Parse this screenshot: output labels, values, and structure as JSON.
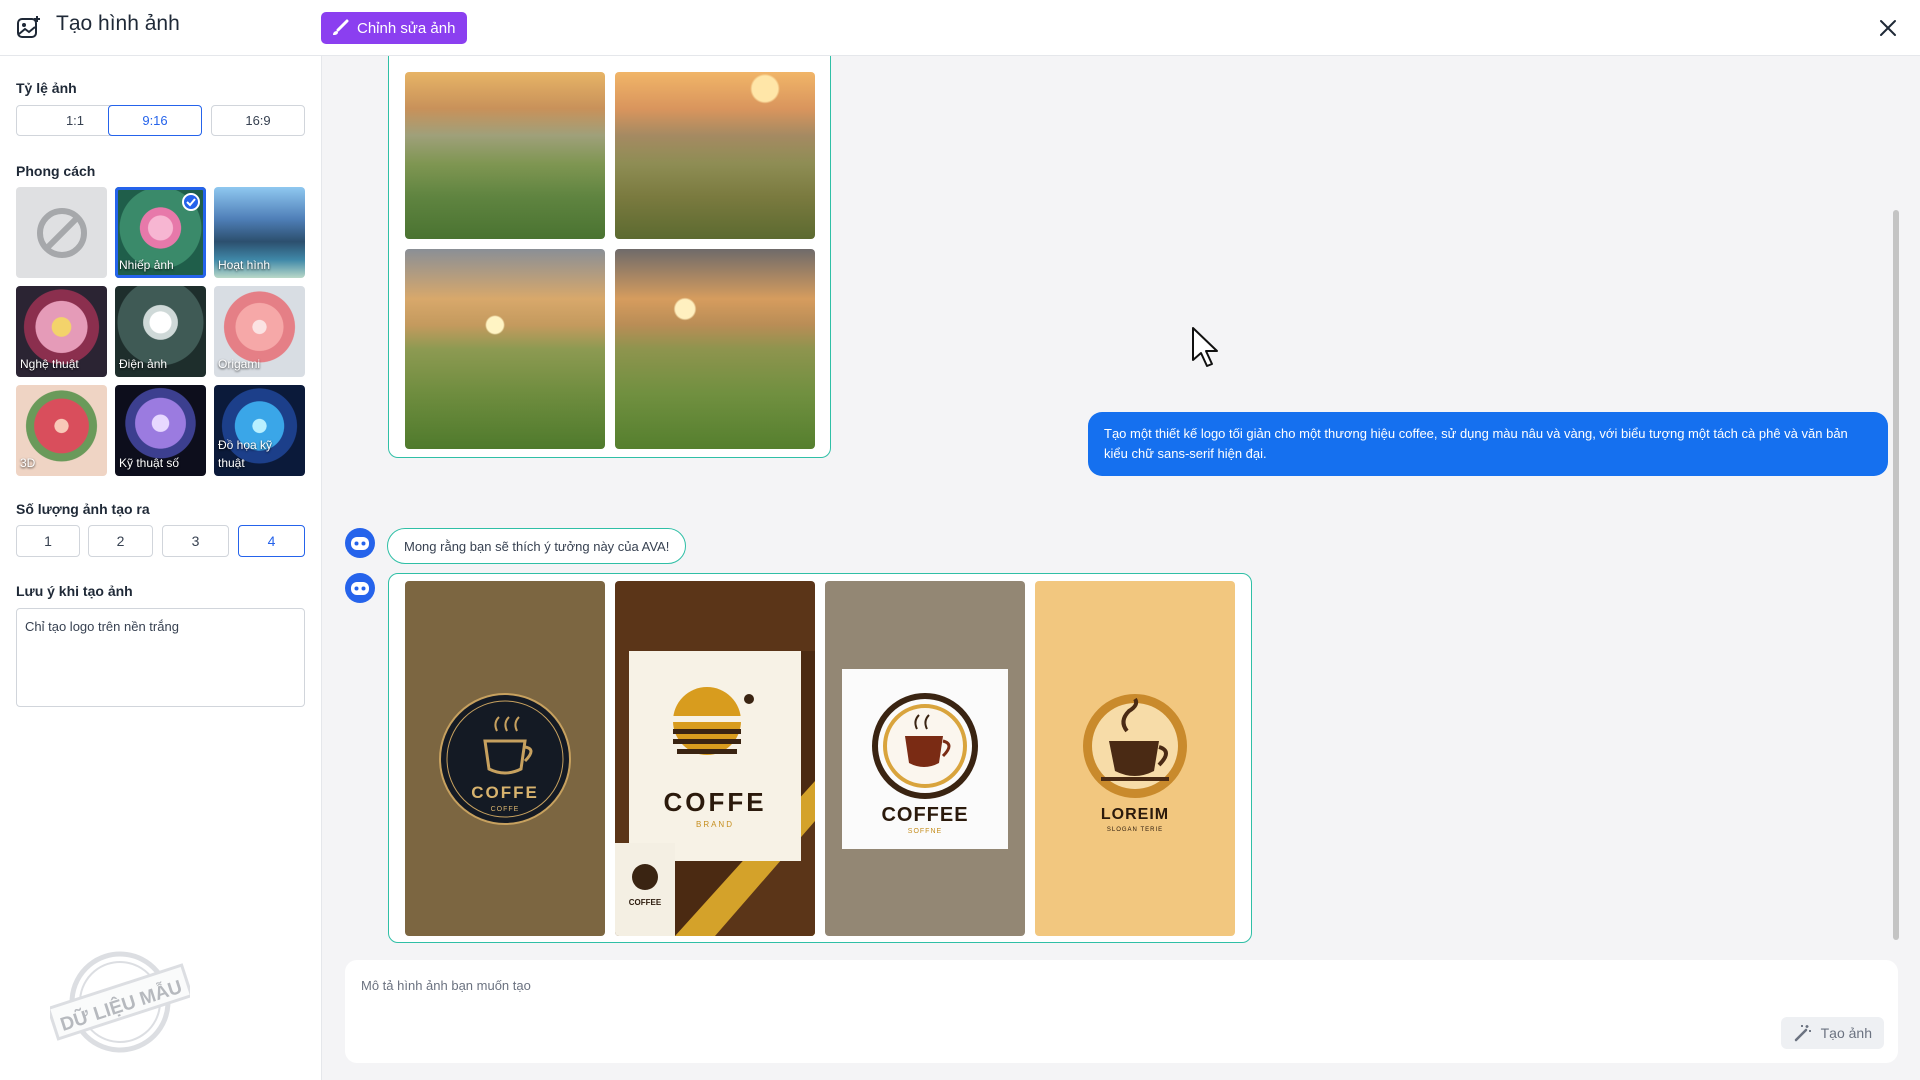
{
  "header": {
    "title": "Tạo hình ảnh",
    "edit_button_label": "Chỉnh sửa ảnh"
  },
  "sidebar": {
    "ratio_label": "Tỷ lệ ảnh",
    "ratios": [
      "1:1",
      "9:16",
      "16:9"
    ],
    "selected_ratio": "9:16",
    "style_label": "Phong cách",
    "styles": [
      "",
      "Nhiếp ảnh",
      "Hoạt hình",
      "Nghệ thuật",
      "Điện ảnh",
      "Origami",
      "3D",
      "Kỹ thuật số",
      "Đồ họa kỹ thuật"
    ],
    "selected_style": "Nhiếp ảnh",
    "quantity_label": "Số lượng ảnh tạo ra",
    "quantities": [
      "1",
      "2",
      "3",
      "4"
    ],
    "selected_quantity": "4",
    "notes_label": "Lưu ý khi tạo ảnh",
    "notes_value": "Chỉ tạo logo trên nền trắng",
    "stamp_text": "DỮ LIỆU MẪU"
  },
  "chat": {
    "user_message": "Tạo một thiết kế logo tối giản cho một thương hiệu coffee, sử dụng màu nâu và vàng, với biểu tượng một tách cà phê và văn bản kiểu chữ sans-serif hiện đại.",
    "bot_message": "Mong rằng bạn sẽ thích ý tưởng này của AVA!",
    "logos": [
      {
        "main": "COFFE",
        "sub": "COFFE"
      },
      {
        "main": "COFFE",
        "sub": "BRAND",
        "mini": "COFFEE"
      },
      {
        "main": "COFFEE",
        "sub": "SOFFNE"
      },
      {
        "main": "LOREIM",
        "sub": "SLOGAN TERIE"
      }
    ]
  },
  "prompt": {
    "placeholder": "Mô tả hình ảnh bạn muốn tạo",
    "generate_label": "Tạo ảnh"
  },
  "colors": {
    "accent": "#1570ef",
    "edit_button": "#8b3ff0",
    "card_border": "#2fbfa6"
  }
}
